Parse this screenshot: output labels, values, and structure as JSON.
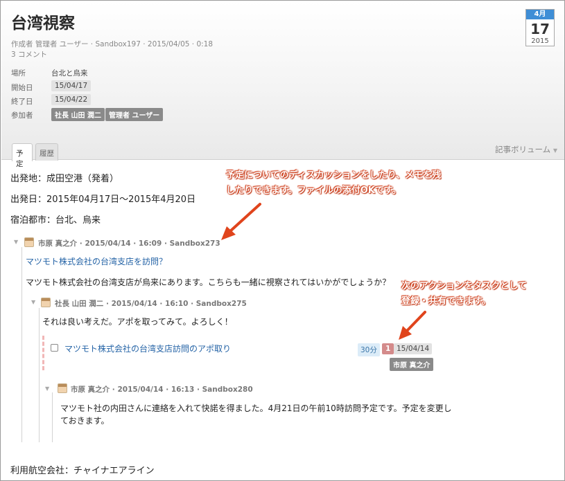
{
  "header": {
    "title": "台湾視察",
    "meta_line": "作成者 管理者 ユーザー · Sandbox197 · 2015/04/05 · 0:18",
    "comments_count": "3 コメント",
    "fields": {
      "location_label": "場所",
      "location_value": "台北と烏来",
      "start_label": "開始日",
      "start_value": "15/04/17",
      "end_label": "終了日",
      "end_value": "15/04/22",
      "participants_label": "参加者",
      "participants": [
        "社長 山田 潤二",
        "管理者 ユーザー"
      ]
    },
    "calendar": {
      "month": "4月",
      "day": "17",
      "year": "2015"
    }
  },
  "tabs": [
    {
      "label": "予定",
      "active": true
    },
    {
      "label": "履歴",
      "active": false
    }
  ],
  "volume_button": "記事ボリューム",
  "body_lines": [
    "出発地：成田空港（発着）",
    "出発日：2015年04月17日〜2015年4月20日",
    "宿泊都市：台北、烏来"
  ],
  "callouts": {
    "top_line1": "予定についてのディスカッションをしたり、メモを残",
    "top_line2": "したりできます。ファイルの添付OKです。",
    "right_line1": "次のアクションをタスクとして",
    "right_line2": "登録・共有できます。"
  },
  "thread": {
    "comment1": {
      "meta": "市原 真之介 · 2015/04/14 · 16:09 · Sandbox273",
      "link": "マツモト株式会社の台湾支店を訪問？",
      "text": "マツモト株式会社の台湾支店が烏来にあります。こちらも一緒に視察されてはいかがでしょうか？"
    },
    "comment2": {
      "meta": "社長 山田 潤二 · 2015/04/14 · 16:10 · Sandbox275",
      "text": "それは良い考えだ。アポを取ってみて。よろしく！"
    },
    "task": {
      "title": "マツモト株式会社の台湾支店訪問のアポ取り",
      "estimate": "30分",
      "priority": "1",
      "due": "15/04/14",
      "assignee": "市原 真之介"
    },
    "comment3": {
      "meta": "市原 真之介 · 2015/04/14 · 16:13 · Sandbox280",
      "text_line1": "マツモト社の内田さんに連絡を入れて快諾を得ました。4月21日の午前10時訪問予定です。予定を変更し",
      "text_line2": "ておきます。"
    }
  },
  "footer_line": "利用航空会社：チャイナエアライン",
  "colors": {
    "accent_blue": "#3f8ed6",
    "link_blue": "#2463a6",
    "callout_red": "#d1401d",
    "chip_gray": "#8a8a8a"
  }
}
